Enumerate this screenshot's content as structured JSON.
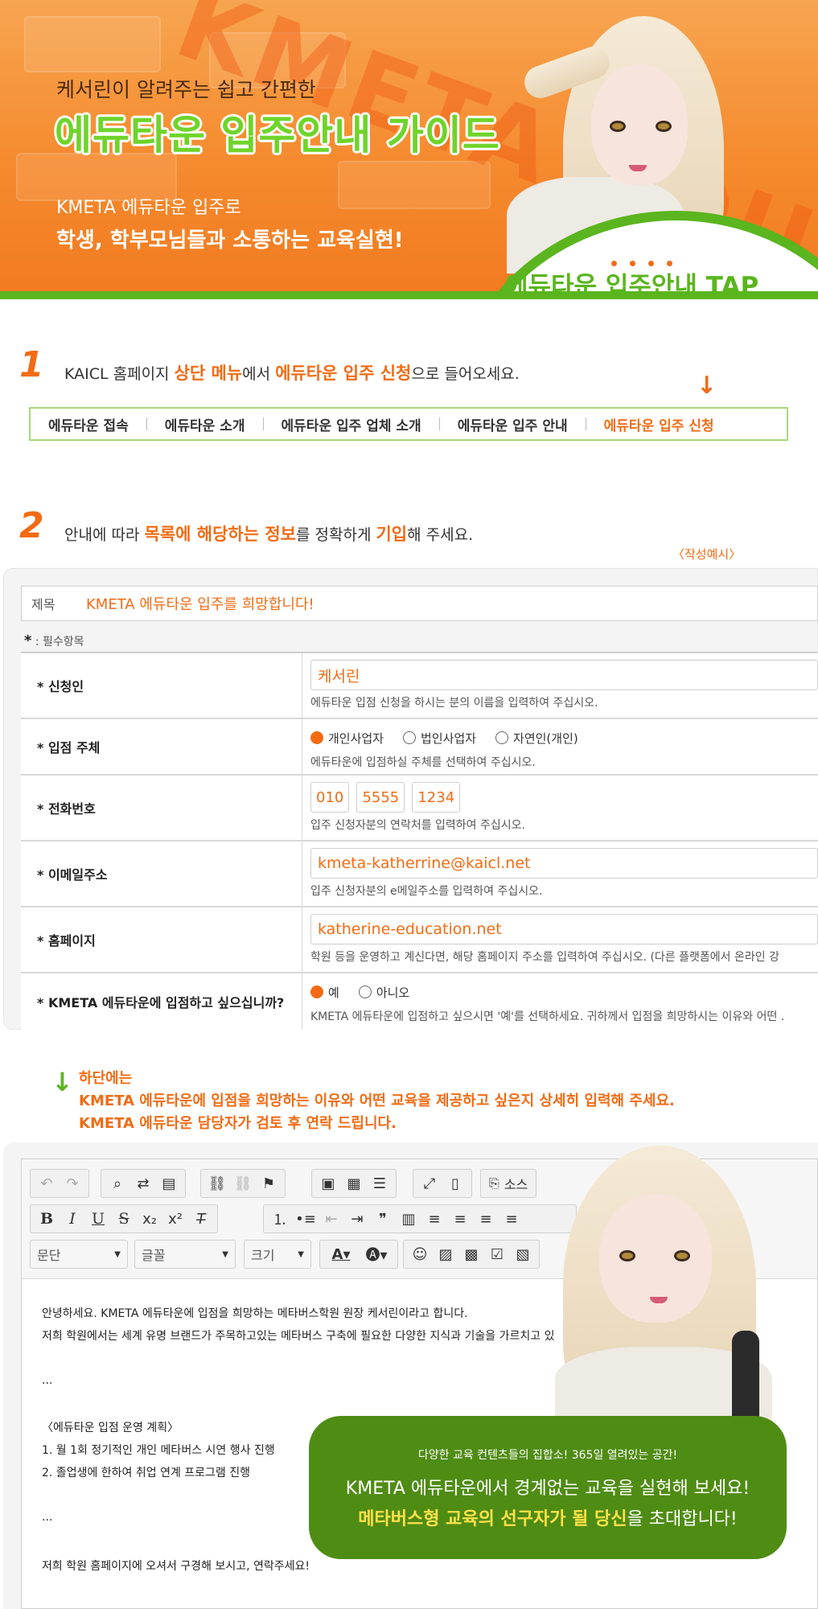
{
  "hero": {
    "watermark": "KMETA EDU",
    "subtitle": "케서린이 알려주는 쉽고 간편한",
    "title": "에듀타운 입주안내 가이드",
    "line1": "KMETA 에듀타운 입주로",
    "line2": "학생, 학부모님들과 소통하는 교육실현!",
    "tap_label": "에듀타운 입주안내 TAP"
  },
  "step1": {
    "number": "1",
    "text_a": "KAICL 홈페이지 ",
    "text_b": "상단 메뉴",
    "text_c": "에서 ",
    "text_d": "에듀타운 입주 신청",
    "text_e": "으로 들어오세요.",
    "arrow": "↓",
    "nav": [
      "에듀타운 접속",
      "에듀타운 소개",
      "에듀타운 입주 업체 소개",
      "에듀타운 입주 안내",
      "에듀타운 입주 신청"
    ]
  },
  "step2": {
    "number": "2",
    "text_a": "안내에 따라 ",
    "text_b": "목록에 해당하는 정보",
    "text_c": "를 정확하게 ",
    "text_d": "기입",
    "text_e": "해 주세요.",
    "example_label": "〈작성예시〉"
  },
  "form": {
    "subject_label": "제목",
    "subject_value": "KMETA 에듀타운 입주를 희망합니다!",
    "required_star": "*",
    "required_note": " : 필수항목",
    "applicant_label": "* 신청인",
    "applicant_value": "케서린",
    "applicant_help": "에듀타운 입점 신청을 하시는 분의 이름을 입력하여 주십시오.",
    "entity_label": "* 입점 주체",
    "entity_options": [
      "개인사업자",
      "법인사업자",
      "자연인(개인)"
    ],
    "entity_help": "에듀타운에 입점하실 주체를 선택하여 주십시오.",
    "phone_label": "* 전화번호",
    "phone_parts": [
      "010",
      "5555",
      "1234"
    ],
    "phone_help": "입주 신청자분의 연락처를 입력하여 주십시오.",
    "email_label": "* 이메일주소",
    "email_value": "kmeta-katherrine@kaicl.net",
    "email_help": "입주 신청자분의 e메일주소를 입력하여 주십시오.",
    "homepage_label": "* 홈페이지",
    "homepage_value": "katherine-education.net",
    "homepage_help": "학원 등을 운영하고 계신다면, 해당 홈페이지 주소를 입력하여 주십시오. (다른 플랫폼에서 온라인 강",
    "wish_label": "* KMETA 에듀타운에 입점하고 싶으십니까?",
    "wish_options": [
      "예",
      "아니오"
    ],
    "wish_help": "KMETA 에듀타운에 입점하고 싶으시면 '예'를 선택하세요. 귀하께서 입점을 희망하시는 이유와 어떤 ."
  },
  "note": {
    "arrow": "↓",
    "title": "하단에는",
    "line1": "KMETA 에듀타운에 입점을 희망하는 이유와 어떤 교육을 제공하고 싶은지 상세히 입력해 주세요.",
    "line2": "KMETA 에듀타운 담당자가 검토 후 연락 드립니다."
  },
  "editor": {
    "source_label": "소스",
    "select_paragraph": "문단",
    "select_font": "글꼴",
    "select_size": "크기",
    "content": [
      "안녕하세요. KMETA 에듀타운에 입점을 희망하는 메타버스학원 원장 케서린이라고 합니다.",
      "저희 학원에서는 세계 유명 브랜드가 주목하고있는 메타버스 구축에 필요한 다양한 지식과 기술을 가르치고 있",
      "...",
      "〈에듀타운 입점 운영 계획〉",
      "1. 월 1회 정기적인 개인 메타버스 시연 행사 진행",
      "2. 졸업생에 한하여 취업 연계 프로그램 진행",
      "...",
      "저희 학원  홈페이지에 오셔서 구경해 보시고, 연락주세요!"
    ]
  },
  "banner": {
    "small": "다양한 교육 컨텐츠들의 집합소! 365일 열려있는 공간!",
    "line1": "KMETA 에듀타운에서 경계없는 교육을 실현해 보세요!",
    "line2_highlight": "메타버스형 교육의 선구자가 될 당신",
    "line2_rest": "을 초대합니다!"
  },
  "colors": {
    "orange": "#f26b14",
    "green": "#5ab51e",
    "dark_green": "#4f8c14"
  }
}
